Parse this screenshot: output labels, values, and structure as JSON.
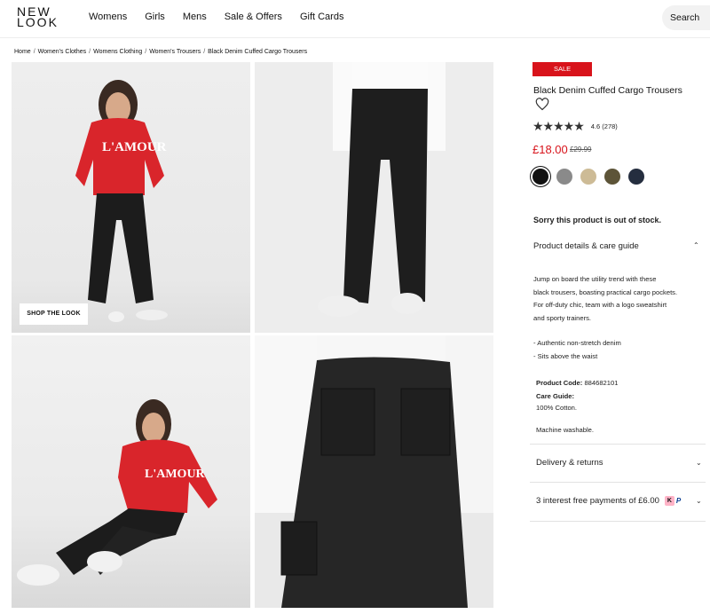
{
  "header": {
    "logo_line1": "NEW",
    "logo_line2": "LOOK",
    "nav": [
      "Womens",
      "Girls",
      "Mens",
      "Sale & Offers",
      "Gift Cards"
    ],
    "search_label": "Search"
  },
  "breadcrumb": [
    "Home",
    "Women's Clothes",
    "Womens Clothing",
    "Women's Trousers",
    "Black Denim Cuffed Cargo Trousers"
  ],
  "gallery": {
    "shop_the_look": "SHOP THE LOOK",
    "sweatshirt_text": "L'AMOUR"
  },
  "product": {
    "badge": "SALE",
    "title": "Black Denim Cuffed Cargo Trousers",
    "stars": "★★★★★",
    "rating_text": "4.6 (278)",
    "price": "£18.00",
    "was_price": "£29.99",
    "swatches": [
      {
        "name": "black",
        "color": "#111111"
      },
      {
        "name": "grey",
        "color": "#8a8a8a"
      },
      {
        "name": "stone",
        "color": "#cdbb96"
      },
      {
        "name": "khaki",
        "color": "#5d5438"
      },
      {
        "name": "navy",
        "color": "#252e3f"
      }
    ],
    "out_of_stock": "Sorry this product is out of stock.",
    "details_heading": "Product details & care guide",
    "description_1": "Jump on board the utility trend with these",
    "description_2": "black trousers, boasting practical cargo pockets.",
    "description_3": "For off-duty chic, team with a logo sweatshirt",
    "description_4": "and sporty trainers.",
    "bullet_1": "- Authentic non-stretch denim",
    "bullet_2": "- Sits above the waist",
    "product_code_label": "Product Code:",
    "product_code": "884682101",
    "care_label": "Care Guide:",
    "care_1": "100% Cotton.",
    "care_2": "Machine washable.",
    "delivery_heading": "Delivery & returns",
    "payments_text": "3 interest free payments of £6.00",
    "klarna_label": "K",
    "paypal_label": "P"
  },
  "colors": {
    "sale_red": "#d8131b",
    "text": "#222222"
  }
}
